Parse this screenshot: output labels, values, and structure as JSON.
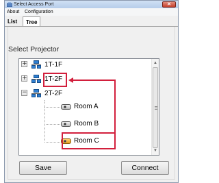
{
  "window": {
    "title": "Select Access Port",
    "close_glyph": "✕"
  },
  "menu": [
    {
      "label": "About"
    },
    {
      "label": "Configuration"
    }
  ],
  "tabs": [
    {
      "label": "List",
      "selected": false
    },
    {
      "label": "Tree",
      "selected": true
    }
  ],
  "section_label": "Select Projector",
  "tree": {
    "nodes": [
      {
        "label": "1T-1F",
        "type": "network-group",
        "expander": "+",
        "expanded": false,
        "icon": "network-icon"
      },
      {
        "label": "1T-2F",
        "type": "network-group",
        "expander": "+",
        "expanded": false,
        "icon": "network-icon",
        "highlighted": true
      },
      {
        "label": "2T-2F",
        "type": "network-group",
        "expander": "−",
        "expanded": true,
        "icon": "network-icon"
      },
      {
        "label": "Room A",
        "type": "projector",
        "icon": "projector-icon",
        "parent": "2T-2F"
      },
      {
        "label": "Room B",
        "type": "projector",
        "icon": "projector-icon",
        "parent": "2T-2F"
      },
      {
        "label": "Room C",
        "type": "projector",
        "icon": "projector-icon",
        "parent": "2T-2F",
        "selected": true,
        "highlighted": true
      }
    ]
  },
  "scrollbar": {
    "up_glyph": "▲",
    "down_glyph": "▼"
  },
  "buttons": {
    "save_label": "Save",
    "connect_label": "Connect"
  },
  "colors": {
    "highlight": "#d21f3c",
    "selected_icon": "#f0a020",
    "network_icon": "#2f7fd1"
  }
}
